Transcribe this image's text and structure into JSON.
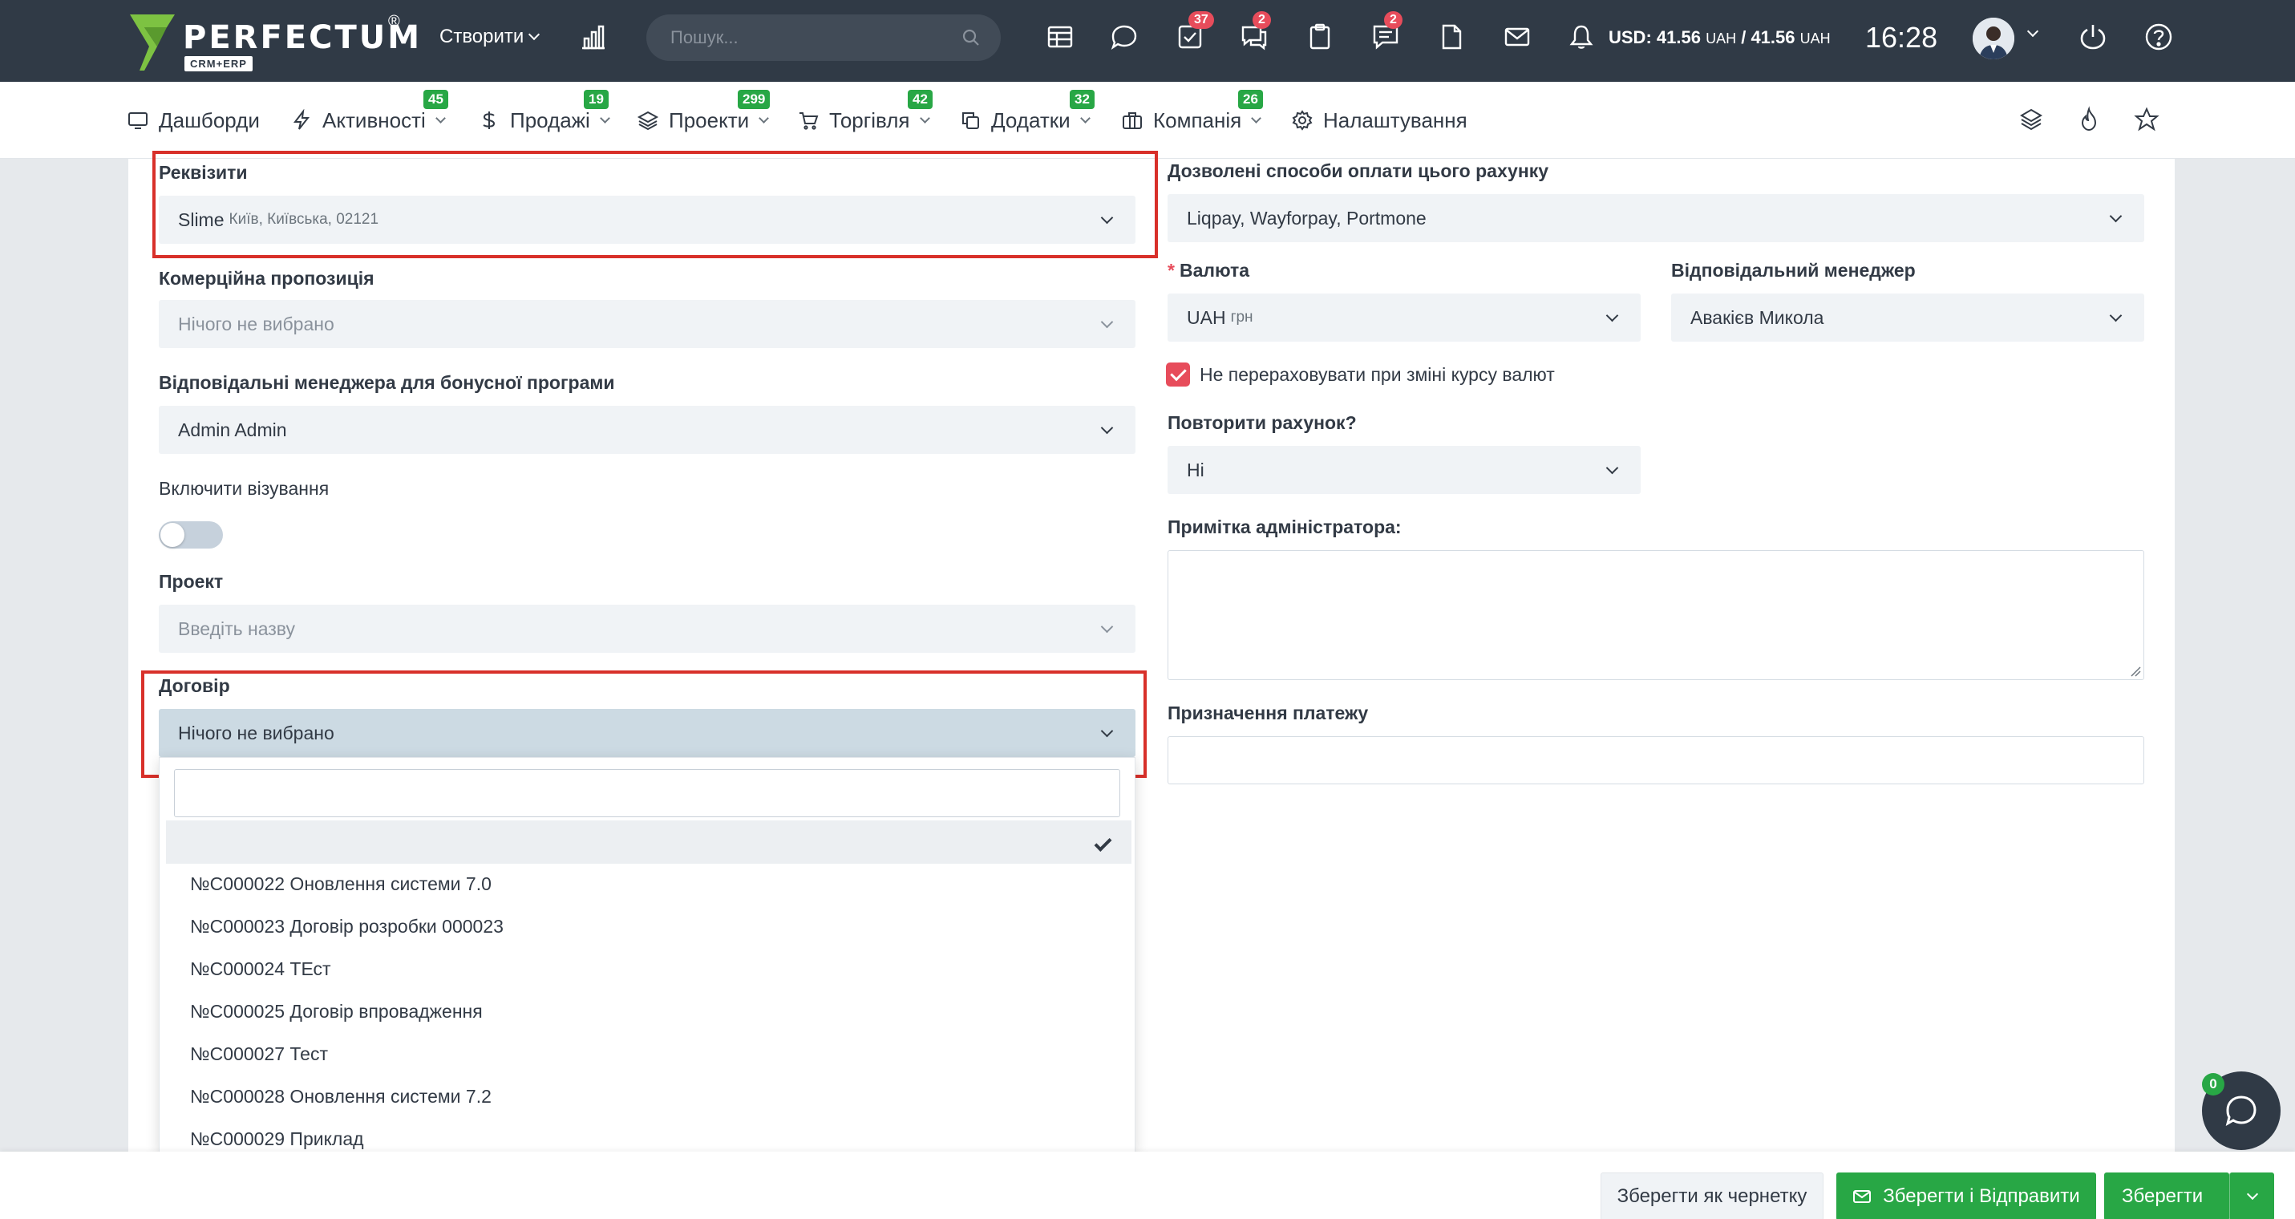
{
  "header": {
    "logo_text": "PERFECTUM",
    "logo_reg": "®",
    "logo_sub": "CRM+ERP",
    "create_label": "Створити",
    "search_placeholder": "Пошук...",
    "badges": {
      "tasks": "37",
      "messages": "2",
      "discussions": "2"
    },
    "currency_label": "USD: 41.56",
    "currency_unit": "UAH",
    "currency_sep": "/ 41.56",
    "currency_unit2": "UAH",
    "time": "16:28"
  },
  "nav": {
    "items": [
      {
        "label": "Дашборди",
        "badge": ""
      },
      {
        "label": "Активності",
        "badge": "45"
      },
      {
        "label": "Продажі",
        "badge": "19"
      },
      {
        "label": "Проекти",
        "badge": "299"
      },
      {
        "label": "Торгівля",
        "badge": "42"
      },
      {
        "label": "Додатки",
        "badge": "32"
      },
      {
        "label": "Компанія",
        "badge": "26"
      },
      {
        "label": "Налаштування",
        "badge": ""
      }
    ]
  },
  "form": {
    "requisites": {
      "label": "Реквізити",
      "value": "Slime",
      "detail": "Київ, Київська, 02121"
    },
    "commercial": {
      "label": "Комерційна пропозиція",
      "value": "Нічого не вибрано"
    },
    "bonus_managers": {
      "label": "Відповідальні менеджера для бонусної програми",
      "value": "Admin Admin"
    },
    "visa": {
      "label": "Включити візування"
    },
    "project": {
      "label": "Проект",
      "placeholder": "Введіть назву"
    },
    "contract": {
      "label": "Договір",
      "value": "Нічого не вибрано",
      "options": [
        "№C000022 Оновлення системи 7.0",
        "№C000023 Договір розробки 000023",
        "№C000024 ТЕст",
        "№C000025 Договір впровадження",
        "№C000027 Тест",
        "№C000028 Оновлення системи 7.2",
        "№C000029 Приклад"
      ]
    },
    "payment_methods": {
      "label": "Дозволені способи оплати цього рахунку",
      "value": "Liqpay, Wayforpay, Portmone"
    },
    "currency": {
      "required": "*",
      "label": "Валюта",
      "value": "UAH",
      "detail": "грн"
    },
    "manager": {
      "label": "Відповідальний менеджер",
      "value": "Авакієв Микола"
    },
    "no_recalc": {
      "label": "Не перераховувати при зміні курсу валют",
      "checked": true
    },
    "repeat": {
      "label": "Повторити рахунок?",
      "value": "Ні"
    },
    "admin_note": {
      "label": "Примітка адміністратора:"
    },
    "payment_purpose": {
      "label": "Призначення платежу"
    }
  },
  "chat": {
    "badge": "0"
  },
  "footer": {
    "draft": "Зберегти як чернетку",
    "save_send": "Зберегти і Відправити",
    "save": "Зберегти"
  },
  "colors": {
    "header_bg": "#303a46",
    "badge_red": "#e74c5b",
    "badge_green": "#28a745",
    "highlight": "#d8302a",
    "logo_green": "#7dc242"
  }
}
